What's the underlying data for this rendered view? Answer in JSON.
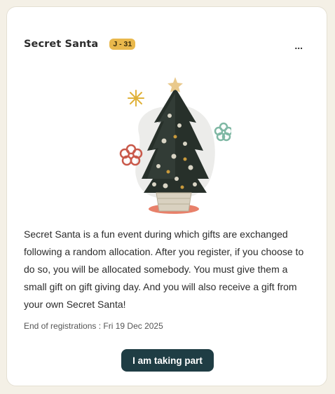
{
  "card": {
    "title": "Secret Santa",
    "badge": "J - 31",
    "more_label": "...",
    "illustration_icon": "christmas-tree-icon",
    "description": "Secret Santa is a fun event during which gifts are exchanged following a random allocation. After you register, if you choose to do so, you will be allocated somebody. You must give them a small gift on gift giving day. And you will also receive a gift from your own Secret Santa!",
    "deadline": "End of registrations : Fri 19 Dec 2025",
    "cta_label": "I am taking part"
  },
  "colors": {
    "badge": "#e9b84c",
    "cta": "#1f3d44",
    "page_bg": "#f4f0e6"
  }
}
